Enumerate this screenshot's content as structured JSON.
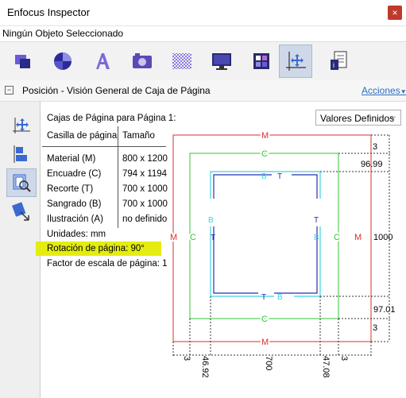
{
  "window": {
    "title": "Enfocus Inspector",
    "close_glyph": "×"
  },
  "status_text": "Ningún Objeto Seleccionado",
  "section": {
    "title": "Posición - Visión General de Caja de Página",
    "actions_label": "Acciones",
    "collapse_glyph": "−"
  },
  "panel": {
    "heading": "Cajas de Página para Página 1:",
    "dropdown_value": "Valores Definidos",
    "table_headers": {
      "box": "Casilla de página",
      "size": "Tamaño"
    },
    "rows": [
      {
        "box": "Material (M)",
        "size": "800 x 1200"
      },
      {
        "box": "Encuadre (C)",
        "size": "794 x 1194"
      },
      {
        "box": "Recorte (T)",
        "size": "700 x 1000"
      },
      {
        "box": "Sangrado (B)",
        "size": "700 x 1000"
      },
      {
        "box": "Ilustración (A)",
        "size": "no definido"
      }
    ],
    "units": "Unidades: mm",
    "rotation": "Rotación de página: 90°",
    "scale": "Factor de escala de página: 1"
  },
  "diagram": {
    "colors": {
      "media": "#d9302a",
      "crop": "#35c435",
      "bleed": "#3fd2e0",
      "trim": "#2b2bb0"
    },
    "letters": {
      "media": "M",
      "crop": "C",
      "bleed": "B",
      "trim": "T"
    },
    "right_labels": [
      "3",
      "96.99",
      "1000",
      "97.01",
      "3"
    ],
    "bottom_labels": [
      "3",
      "46.92",
      "700",
      "47.08",
      "3"
    ]
  },
  "icons": {
    "toolbar": [
      "object-icon",
      "color-icon",
      "text-icon",
      "image-icon",
      "transparency-icon",
      "display-icon",
      "swatches-icon",
      "position-icon",
      "document-icon"
    ],
    "sidebar": [
      "move-icon",
      "align-icon",
      "page-box-icon",
      "resize-icon"
    ]
  }
}
